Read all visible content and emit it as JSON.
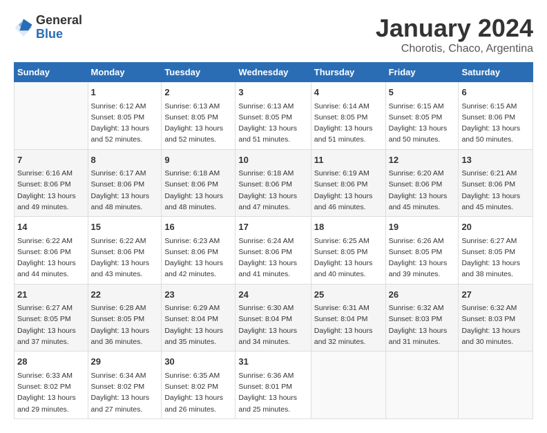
{
  "header": {
    "logo_line1": "General",
    "logo_line2": "Blue",
    "month_title": "January 2024",
    "location": "Chorotis, Chaco, Argentina"
  },
  "weekdays": [
    "Sunday",
    "Monday",
    "Tuesday",
    "Wednesday",
    "Thursday",
    "Friday",
    "Saturday"
  ],
  "weeks": [
    [
      {
        "day": "",
        "info": ""
      },
      {
        "day": "1",
        "info": "Sunrise: 6:12 AM\nSunset: 8:05 PM\nDaylight: 13 hours\nand 52 minutes."
      },
      {
        "day": "2",
        "info": "Sunrise: 6:13 AM\nSunset: 8:05 PM\nDaylight: 13 hours\nand 52 minutes."
      },
      {
        "day": "3",
        "info": "Sunrise: 6:13 AM\nSunset: 8:05 PM\nDaylight: 13 hours\nand 51 minutes."
      },
      {
        "day": "4",
        "info": "Sunrise: 6:14 AM\nSunset: 8:05 PM\nDaylight: 13 hours\nand 51 minutes."
      },
      {
        "day": "5",
        "info": "Sunrise: 6:15 AM\nSunset: 8:05 PM\nDaylight: 13 hours\nand 50 minutes."
      },
      {
        "day": "6",
        "info": "Sunrise: 6:15 AM\nSunset: 8:06 PM\nDaylight: 13 hours\nand 50 minutes."
      }
    ],
    [
      {
        "day": "7",
        "info": "Sunrise: 6:16 AM\nSunset: 8:06 PM\nDaylight: 13 hours\nand 49 minutes."
      },
      {
        "day": "8",
        "info": "Sunrise: 6:17 AM\nSunset: 8:06 PM\nDaylight: 13 hours\nand 48 minutes."
      },
      {
        "day": "9",
        "info": "Sunrise: 6:18 AM\nSunset: 8:06 PM\nDaylight: 13 hours\nand 48 minutes."
      },
      {
        "day": "10",
        "info": "Sunrise: 6:18 AM\nSunset: 8:06 PM\nDaylight: 13 hours\nand 47 minutes."
      },
      {
        "day": "11",
        "info": "Sunrise: 6:19 AM\nSunset: 8:06 PM\nDaylight: 13 hours\nand 46 minutes."
      },
      {
        "day": "12",
        "info": "Sunrise: 6:20 AM\nSunset: 8:06 PM\nDaylight: 13 hours\nand 45 minutes."
      },
      {
        "day": "13",
        "info": "Sunrise: 6:21 AM\nSunset: 8:06 PM\nDaylight: 13 hours\nand 45 minutes."
      }
    ],
    [
      {
        "day": "14",
        "info": "Sunrise: 6:22 AM\nSunset: 8:06 PM\nDaylight: 13 hours\nand 44 minutes."
      },
      {
        "day": "15",
        "info": "Sunrise: 6:22 AM\nSunset: 8:06 PM\nDaylight: 13 hours\nand 43 minutes."
      },
      {
        "day": "16",
        "info": "Sunrise: 6:23 AM\nSunset: 8:06 PM\nDaylight: 13 hours\nand 42 minutes."
      },
      {
        "day": "17",
        "info": "Sunrise: 6:24 AM\nSunset: 8:06 PM\nDaylight: 13 hours\nand 41 minutes."
      },
      {
        "day": "18",
        "info": "Sunrise: 6:25 AM\nSunset: 8:05 PM\nDaylight: 13 hours\nand 40 minutes."
      },
      {
        "day": "19",
        "info": "Sunrise: 6:26 AM\nSunset: 8:05 PM\nDaylight: 13 hours\nand 39 minutes."
      },
      {
        "day": "20",
        "info": "Sunrise: 6:27 AM\nSunset: 8:05 PM\nDaylight: 13 hours\nand 38 minutes."
      }
    ],
    [
      {
        "day": "21",
        "info": "Sunrise: 6:27 AM\nSunset: 8:05 PM\nDaylight: 13 hours\nand 37 minutes."
      },
      {
        "day": "22",
        "info": "Sunrise: 6:28 AM\nSunset: 8:05 PM\nDaylight: 13 hours\nand 36 minutes."
      },
      {
        "day": "23",
        "info": "Sunrise: 6:29 AM\nSunset: 8:04 PM\nDaylight: 13 hours\nand 35 minutes."
      },
      {
        "day": "24",
        "info": "Sunrise: 6:30 AM\nSunset: 8:04 PM\nDaylight: 13 hours\nand 34 minutes."
      },
      {
        "day": "25",
        "info": "Sunrise: 6:31 AM\nSunset: 8:04 PM\nDaylight: 13 hours\nand 32 minutes."
      },
      {
        "day": "26",
        "info": "Sunrise: 6:32 AM\nSunset: 8:03 PM\nDaylight: 13 hours\nand 31 minutes."
      },
      {
        "day": "27",
        "info": "Sunrise: 6:32 AM\nSunset: 8:03 PM\nDaylight: 13 hours\nand 30 minutes."
      }
    ],
    [
      {
        "day": "28",
        "info": "Sunrise: 6:33 AM\nSunset: 8:02 PM\nDaylight: 13 hours\nand 29 minutes."
      },
      {
        "day": "29",
        "info": "Sunrise: 6:34 AM\nSunset: 8:02 PM\nDaylight: 13 hours\nand 27 minutes."
      },
      {
        "day": "30",
        "info": "Sunrise: 6:35 AM\nSunset: 8:02 PM\nDaylight: 13 hours\nand 26 minutes."
      },
      {
        "day": "31",
        "info": "Sunrise: 6:36 AM\nSunset: 8:01 PM\nDaylight: 13 hours\nand 25 minutes."
      },
      {
        "day": "",
        "info": ""
      },
      {
        "day": "",
        "info": ""
      },
      {
        "day": "",
        "info": ""
      }
    ]
  ]
}
